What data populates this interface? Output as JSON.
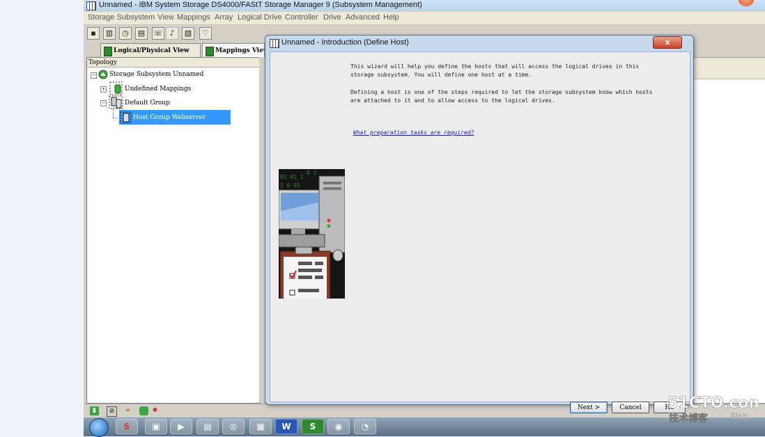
{
  "app": {
    "title": "Unnamed - IBM System Storage DS4000/FAStT Storage Manager 9 (Subsystem Management)",
    "menu": [
      "Storage Subsystem",
      "View",
      "Mappings",
      "Array",
      "Logical Drive",
      "Controller",
      "Drive",
      "Advanced",
      "Help"
    ],
    "tabs": [
      "Logical/Physical View",
      "Mappings View"
    ],
    "tree": {
      "header": "Topology",
      "items": [
        {
          "label": "Storage Subsystem Unnamed",
          "icon": "storage-subsystem-icon"
        },
        {
          "label": "Undefined Mappings",
          "icon": "undefined-mappings-icon"
        },
        {
          "label": "Default Group",
          "icon": "default-group-icon"
        },
        {
          "label": "Host Group Webserver",
          "icon": "host-group-icon",
          "selected": true
        }
      ]
    }
  },
  "dialog": {
    "title": "Unnamed - Introduction (Define Host)",
    "close_label": "x",
    "paragraph1_line1": "This wizard will help you define the hosts that will access the logical drives in this",
    "paragraph1_line2": "storage subsystem.  You will define one host at a time.",
    "paragraph2_line1": "Defining a host is one of the steps required to let the storage subsystem know which hosts",
    "paragraph2_line2": "are attached to it and to allow access to the logical drives.",
    "link": "What preparation tasks are required?",
    "buttons": {
      "next": "Next >",
      "cancel": "Cancel",
      "help": "He"
    }
  },
  "taskbar": {
    "items": [
      "explorer-icon",
      "media-player-icon",
      "notepad-icon",
      "ie-icon",
      "storage-manager-icon",
      "word-icon",
      "excel-icon",
      "globe-icon",
      "app-icon"
    ]
  },
  "watermark": {
    "brand": "51CTO.com",
    "subtitle": "技术博客",
    "blog": "Blog"
  },
  "colors": {
    "selection": "#3399ff",
    "link": "#1a1aa6",
    "taskbar": "#5b7184"
  }
}
